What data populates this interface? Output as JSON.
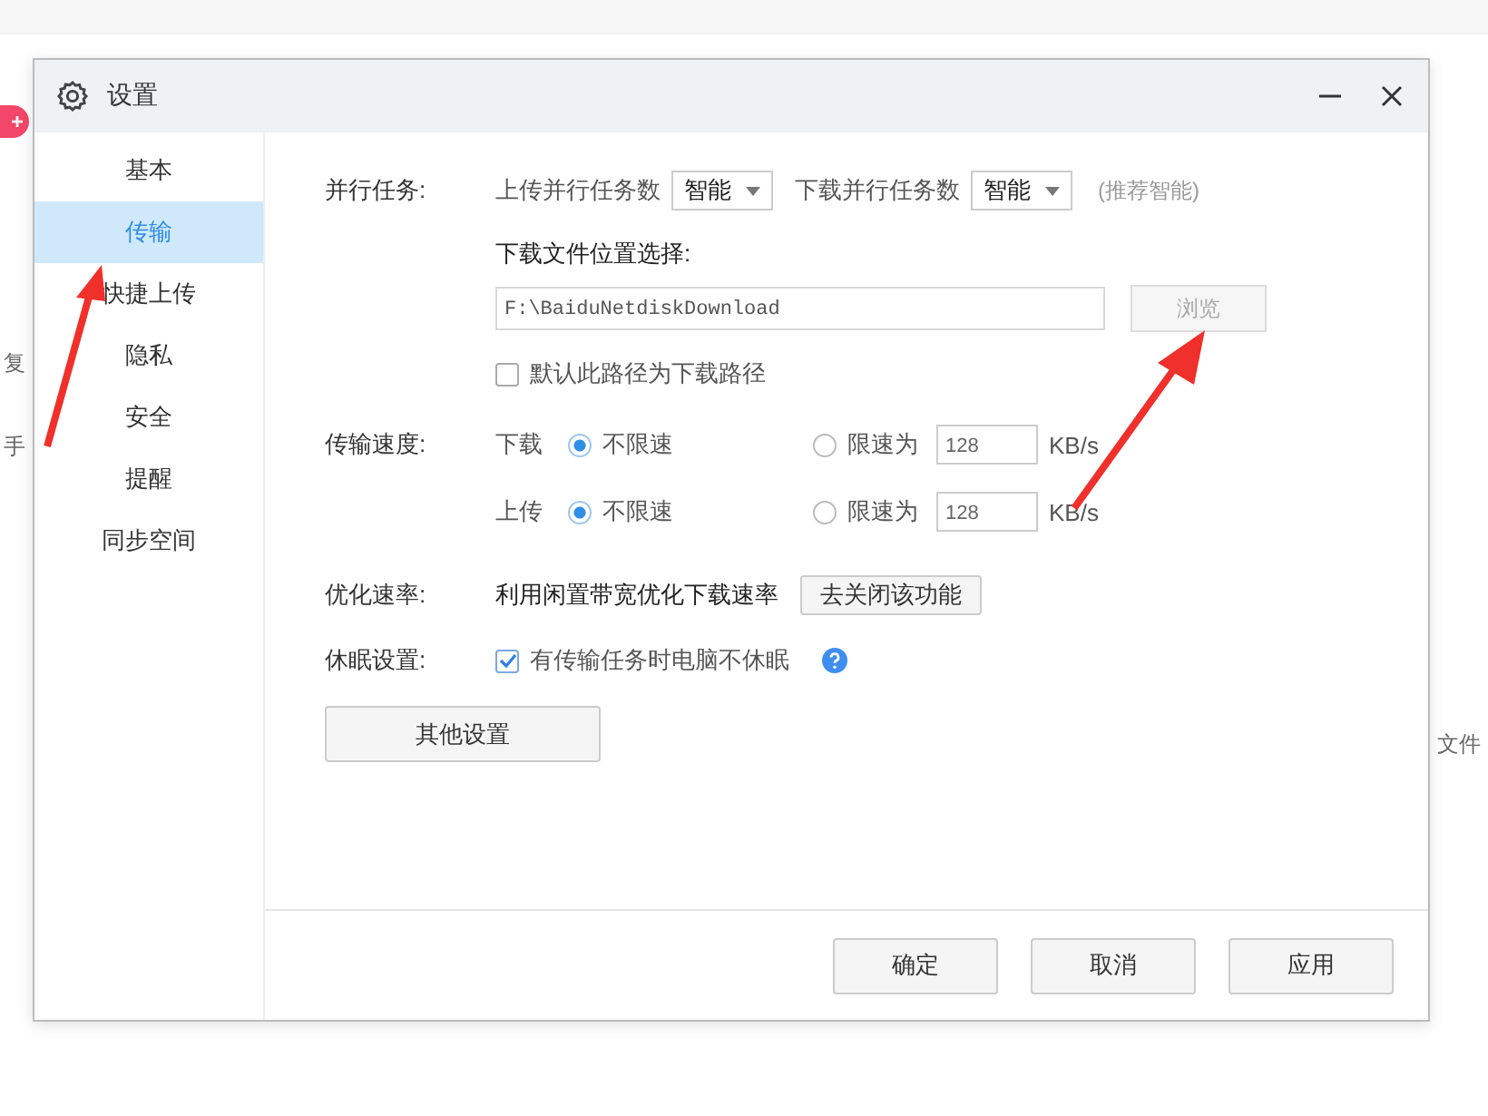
{
  "background": {
    "badge": "+",
    "fragments": [
      "复",
      "手",
      "文件"
    ]
  },
  "window": {
    "title": "设置"
  },
  "sidebar": {
    "items": [
      {
        "label": "基本",
        "selected": false
      },
      {
        "label": "传输",
        "selected": true
      },
      {
        "label": "快捷上传",
        "selected": false
      },
      {
        "label": "隐私",
        "selected": false
      },
      {
        "label": "安全",
        "selected": false
      },
      {
        "label": "提醒",
        "selected": false
      },
      {
        "label": "同步空间",
        "selected": false
      }
    ]
  },
  "parallel": {
    "label": "并行任务:",
    "upload_label": "上传并行任务数",
    "upload_value": "智能",
    "download_label": "下载并行任务数",
    "download_value": "智能",
    "hint": "(推荐智能)"
  },
  "download_location": {
    "label": "下载文件位置选择:",
    "path": "F:\\BaiduNetdiskDownload",
    "browse_button": "浏览",
    "browse_disabled": true,
    "default_checkbox": {
      "label": "默认此路径为下载路径",
      "checked": false
    }
  },
  "speed": {
    "label": "传输速度:",
    "rows": [
      {
        "direction": "下载",
        "unlimited": {
          "label": "不限速",
          "selected": true
        },
        "limited": {
          "label": "限速为",
          "selected": false,
          "value": "128",
          "unit": "KB/s"
        }
      },
      {
        "direction": "上传",
        "unlimited": {
          "label": "不限速",
          "selected": true
        },
        "limited": {
          "label": "限速为",
          "selected": false,
          "value": "128",
          "unit": "KB/s"
        }
      }
    ]
  },
  "optimize": {
    "label": "优化速率:",
    "text": "利用闲置带宽优化下载速率",
    "button": "去关闭该功能"
  },
  "sleep": {
    "label": "休眠设置:",
    "checkbox": {
      "label": "有传输任务时电脑不休眠",
      "checked": true
    }
  },
  "other_settings_button": "其他设置",
  "footer_buttons": [
    "确定",
    "取消",
    "应用"
  ]
}
